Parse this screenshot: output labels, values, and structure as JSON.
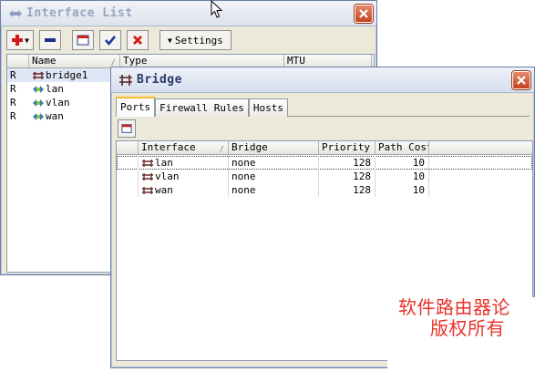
{
  "interface_list": {
    "title": "Interface List",
    "toolbar": {
      "add": "add-icon",
      "remove": "remove-icon",
      "comment": "comment-icon",
      "enable": "enable-icon",
      "disable": "disable-icon",
      "settings_label": "Settings"
    },
    "columns": [
      "",
      "Name",
      "Type",
      "MTU"
    ],
    "rows": [
      {
        "flag": "R",
        "name": "bridge1",
        "icon": "bridge-icon"
      },
      {
        "flag": "R",
        "name": "lan",
        "icon": "ethernet-icon"
      },
      {
        "flag": "R",
        "name": "vlan",
        "icon": "ethernet-icon"
      },
      {
        "flag": "R",
        "name": "wan",
        "icon": "ethernet-icon"
      }
    ]
  },
  "bridge": {
    "title": "Bridge",
    "tabs": [
      "Ports",
      "Firewall Rules",
      "Hosts"
    ],
    "active_tab": "Ports",
    "toolbar": {
      "add": "add-icon"
    },
    "columns": [
      "Interface",
      "Bridge",
      "Priority",
      "Path Cost"
    ],
    "rows": [
      {
        "interface": "lan",
        "bridge": "none",
        "priority": "128",
        "path_cost": "10"
      },
      {
        "interface": "vlan",
        "bridge": "none",
        "priority": "128",
        "path_cost": "10"
      },
      {
        "interface": "wan",
        "bridge": "none",
        "priority": "128",
        "path_cost": "10"
      }
    ]
  },
  "watermark": {
    "line1": "软件路由器论",
    "line2": "版权所有"
  },
  "colors": {
    "accent_tab": "#f9b82d",
    "close_button": "#c4421e",
    "watermark": "#e8322a"
  }
}
